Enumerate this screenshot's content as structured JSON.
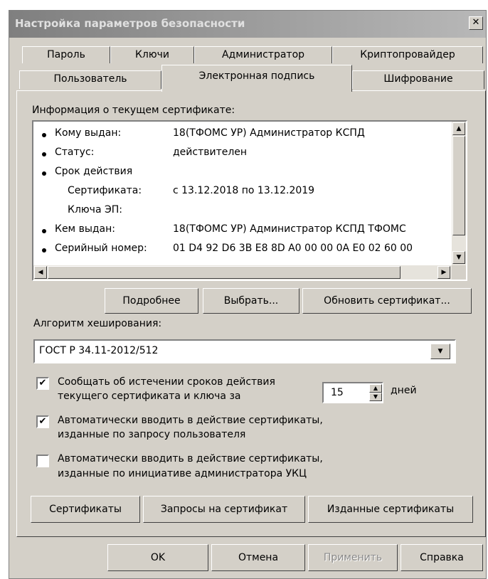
{
  "window": {
    "title": "Настройка параметров безопасности",
    "close_glyph": "✕"
  },
  "tabs": {
    "row1": [
      "Пароль",
      "Ключи",
      "Администратор",
      "Криптопровайдер"
    ],
    "row2": [
      "Пользователь",
      "Электронная подпись",
      "Шифрование"
    ],
    "active": "Электронная подпись"
  },
  "cert_info": {
    "heading": "Информация о текущем сертификате:",
    "rows": [
      {
        "label": "Кому выдан:",
        "value": "18(ТФОМС УР) Администратор КСПД"
      },
      {
        "label": "Статус:",
        "value": "действителен"
      },
      {
        "label": "Срок действия",
        "value": ""
      },
      {
        "label": "Сертификата:",
        "value": "с 13.12.2018 по 13.12.2019"
      },
      {
        "label": "Ключа ЭП:",
        "value": ""
      },
      {
        "label": "Кем выдан:",
        "value": "18(ТФОМС УР) Администратор КСПД ТФОМС"
      },
      {
        "label": "Серийный номер:",
        "value": "01 D4 92 D6 3B E8 8D A0 00 00 0A E0 02 60 00"
      }
    ]
  },
  "cert_buttons": {
    "details": "Подробнее",
    "select": "Выбрать...",
    "update": "Обновить сертификат..."
  },
  "hash": {
    "label": "Алгоритм хеширования:",
    "value": "ГОСТ Р 34.11-2012/512"
  },
  "options": {
    "notify_line1": "Сообщать об истечении сроков действия",
    "notify_line2": "текущего сертификата и ключа за",
    "notify_checked": true,
    "days_value": "15",
    "days_label": "дней",
    "auto_user_line1": "Автоматически вводить в действие сертификаты,",
    "auto_user_line2": "изданные по запросу пользователя",
    "auto_user_checked": true,
    "auto_admin_line1": "Автоматически вводить в действие сертификаты,",
    "auto_admin_line2": "изданные по инициативе администратора УКЦ",
    "auto_admin_checked": false
  },
  "bottom_buttons": {
    "certificates": "Сертификаты",
    "requests": "Запросы на сертификат",
    "issued": "Изданные сертификаты"
  },
  "dialog_buttons": {
    "ok": "OK",
    "cancel": "Отмена",
    "apply": "Применить",
    "help": "Справка"
  },
  "glyphs": {
    "check": "✔",
    "up": "▲",
    "down": "▼",
    "left": "◀",
    "right": "▶"
  }
}
